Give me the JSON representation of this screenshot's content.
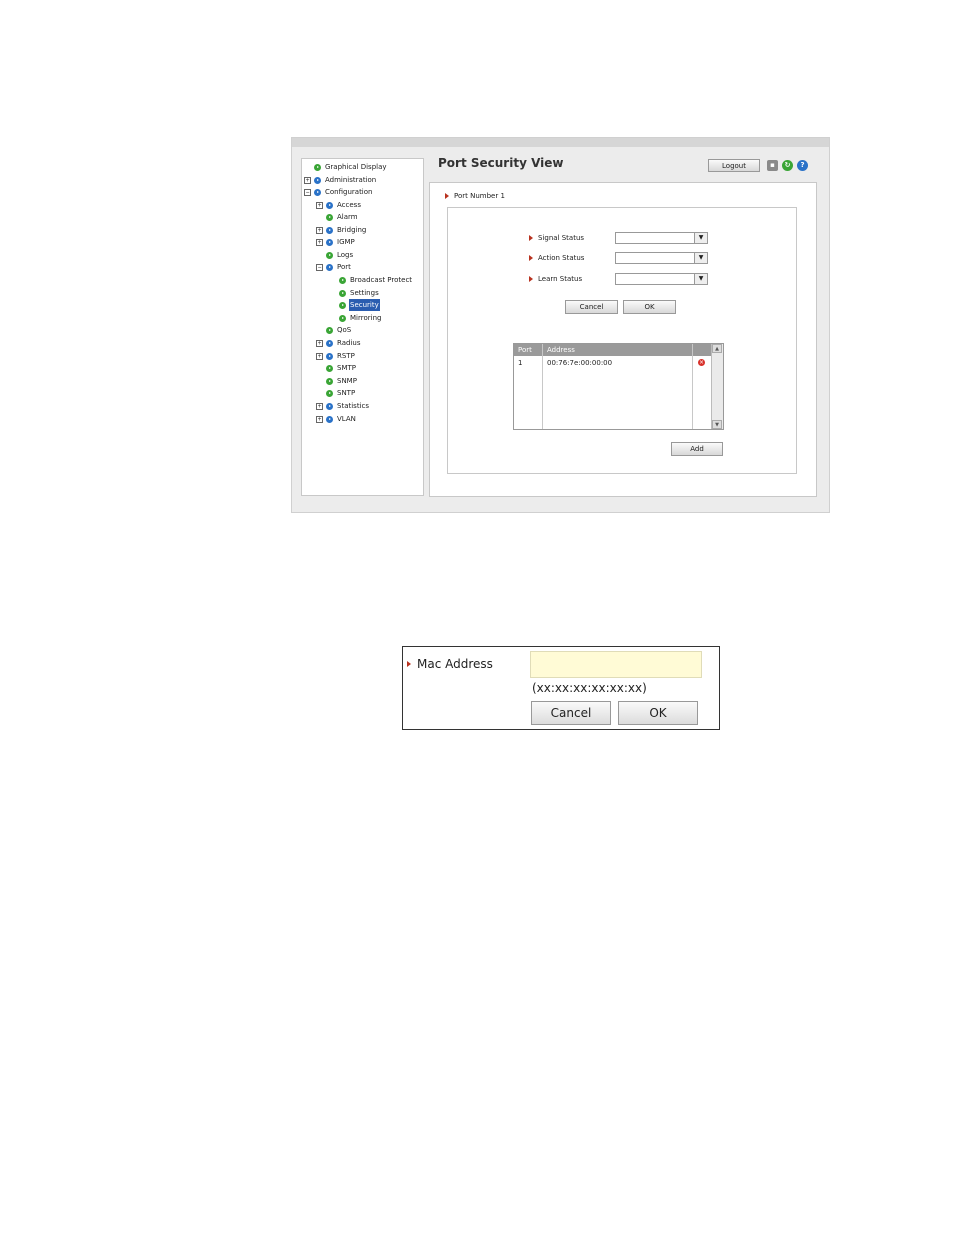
{
  "header": {
    "title": "Port Security View",
    "logout_label": "Logout",
    "icons": [
      "save-icon",
      "refresh-icon",
      "help-icon"
    ]
  },
  "sidebar": {
    "items": [
      {
        "label": "Graphical Display",
        "expander": "",
        "color": "green"
      },
      {
        "label": "Administration",
        "expander": "+",
        "color": "blue"
      },
      {
        "label": "Configuration",
        "expander": "−",
        "color": "blue"
      },
      {
        "label": "Access",
        "expander": "+",
        "color": "blue"
      },
      {
        "label": "Alarm",
        "expander": "",
        "color": "green"
      },
      {
        "label": "Bridging",
        "expander": "+",
        "color": "blue"
      },
      {
        "label": "IGMP",
        "expander": "+",
        "color": "blue"
      },
      {
        "label": "Logs",
        "expander": "",
        "color": "green"
      },
      {
        "label": "Port",
        "expander": "−",
        "color": "blue"
      },
      {
        "label": "Broadcast Protect",
        "expander": "",
        "color": "green"
      },
      {
        "label": "Settings",
        "expander": "",
        "color": "green"
      },
      {
        "label": "Security",
        "expander": "",
        "color": "green",
        "selected": true
      },
      {
        "label": "Mirroring",
        "expander": "",
        "color": "green"
      },
      {
        "label": "QoS",
        "expander": "",
        "color": "green"
      },
      {
        "label": "Radius",
        "expander": "+",
        "color": "blue"
      },
      {
        "label": "RSTP",
        "expander": "+",
        "color": "blue"
      },
      {
        "label": "SMTP",
        "expander": "",
        "color": "green"
      },
      {
        "label": "SNMP",
        "expander": "",
        "color": "green"
      },
      {
        "label": "SNTP",
        "expander": "",
        "color": "green"
      },
      {
        "label": "Statistics",
        "expander": "+",
        "color": "blue"
      },
      {
        "label": "VLAN",
        "expander": "+",
        "color": "blue"
      }
    ]
  },
  "main": {
    "port_number_label": "Port Number 1",
    "signal_status_label": "Signal Status",
    "action_status_label": "Action Status",
    "learn_status_label": "Learn Status",
    "signal_status_value": "",
    "action_status_value": "",
    "learn_status_value": "",
    "cancel_label": "Cancel",
    "ok_label": "OK",
    "table": {
      "columns": [
        "Port",
        "Address"
      ],
      "rows": [
        {
          "port": "1",
          "address": "00:76:7e:00:00:00"
        }
      ]
    },
    "add_label": "Add"
  },
  "mac_dialog": {
    "label": "Mac Address",
    "input_value": "",
    "hint": "(xx:xx:xx:xx:xx:xx)",
    "cancel_label": "Cancel",
    "ok_label": "OK"
  },
  "colors": {
    "accent_arrow": "#b8321f",
    "selected_bg": "#2a5db0",
    "input_bg": "#fffbd6"
  }
}
